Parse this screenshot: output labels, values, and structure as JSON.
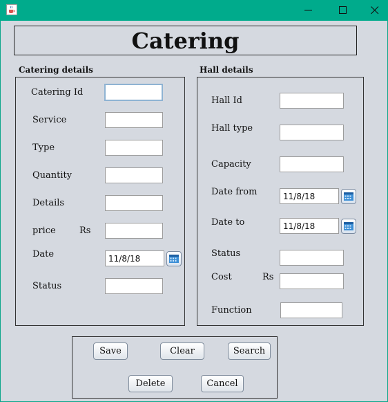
{
  "window": {
    "title_icon": "java-coffee-icon",
    "controls": [
      "minimize-icon",
      "maximize-icon",
      "close-icon"
    ]
  },
  "form": {
    "title": "Catering"
  },
  "catering": {
    "section_label": "Catering details",
    "fields": {
      "catering_id": {
        "label": "Catering Id",
        "value": ""
      },
      "service": {
        "label": "Service",
        "value": ""
      },
      "type": {
        "label": "Type",
        "value": ""
      },
      "quantity": {
        "label": "Quantity",
        "value": ""
      },
      "details": {
        "label": "Details",
        "value": ""
      },
      "price": {
        "label": "price",
        "unit": "Rs",
        "value": ""
      },
      "date": {
        "label": "Date",
        "value": "11/8/18"
      },
      "status": {
        "label": "Status",
        "value": ""
      }
    }
  },
  "hall": {
    "section_label": "Hall details",
    "fields": {
      "hall_id": {
        "label": "Hall Id",
        "value": ""
      },
      "hall_type": {
        "label": "Hall type",
        "value": ""
      },
      "capacity": {
        "label": "Capacity",
        "value": ""
      },
      "date_from": {
        "label": "Date from",
        "value": "11/8/18"
      },
      "date_to": {
        "label": "Date to",
        "value": "11/8/18"
      },
      "status": {
        "label": "Status",
        "value": ""
      },
      "cost": {
        "label": "Cost",
        "unit": "Rs",
        "value": ""
      },
      "function": {
        "label": "Function",
        "value": ""
      }
    }
  },
  "actions": {
    "save": "Save",
    "clear": "Clear",
    "search": "Search",
    "delete": "Delete",
    "cancel": "Cancel"
  },
  "colors": {
    "titlebar": "#00ab8c",
    "background": "#d5d9e0"
  }
}
